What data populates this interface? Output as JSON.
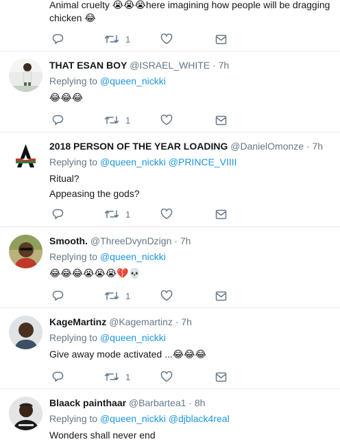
{
  "top_tweet": {
    "text_line1": "Animal cruelty 😭😭😭here imagining how people will be dragging",
    "text_line2": "chicken 😂",
    "retweets": "1"
  },
  "tweets": [
    {
      "name": "THAT ESAN BOY",
      "handle": "@ISRAEL_WHITE",
      "time": "7h",
      "replying_label": "Replying to",
      "mentions": [
        "@queen_nickki"
      ],
      "lines": [
        "😂😂😂"
      ],
      "retweets": "1"
    },
    {
      "name": "2018 PERSON OF THE YEAR LOADING",
      "handle": "@DanielOmonze",
      "time": "7h",
      "replying_label": "Replying to",
      "mentions": [
        "@queen_nickki",
        "@PRINCE_VIIII"
      ],
      "lines": [
        "Ritual?",
        "Appeasing the gods?"
      ],
      "retweets": "1"
    },
    {
      "name": "Smooth.",
      "handle": "@ThreeDvynDzign",
      "time": "7h",
      "replying_label": "Replying to",
      "mentions": [
        "@queen_nickki"
      ],
      "lines": [
        "😂😂😂😭😭😭💔💀"
      ],
      "retweets": "1"
    },
    {
      "name": "KageMartinz",
      "handle": "@Kagemartinz",
      "time": "7h",
      "replying_label": "Replying to",
      "mentions": [
        "@queen_nickki"
      ],
      "lines": [
        "Give away mode activated ...😂😂😂"
      ],
      "retweets": "1"
    },
    {
      "name": "Blaack painthaar",
      "handle": "@Barbartea1",
      "time": "8h",
      "replying_label": "Replying to",
      "mentions": [
        "@queen_nickki",
        "@djblack4real"
      ],
      "lines": [
        "Wonders shall never end"
      ],
      "retweets": ""
    }
  ],
  "separator": "·",
  "icons": {
    "reply": "reply-icon",
    "retweet": "retweet-icon",
    "like": "heart-icon",
    "dm": "envelope-icon"
  },
  "colors": {
    "link": "#1b95e0",
    "muted": "#657786",
    "text": "#14171a",
    "divider": "#e6ecf0"
  }
}
